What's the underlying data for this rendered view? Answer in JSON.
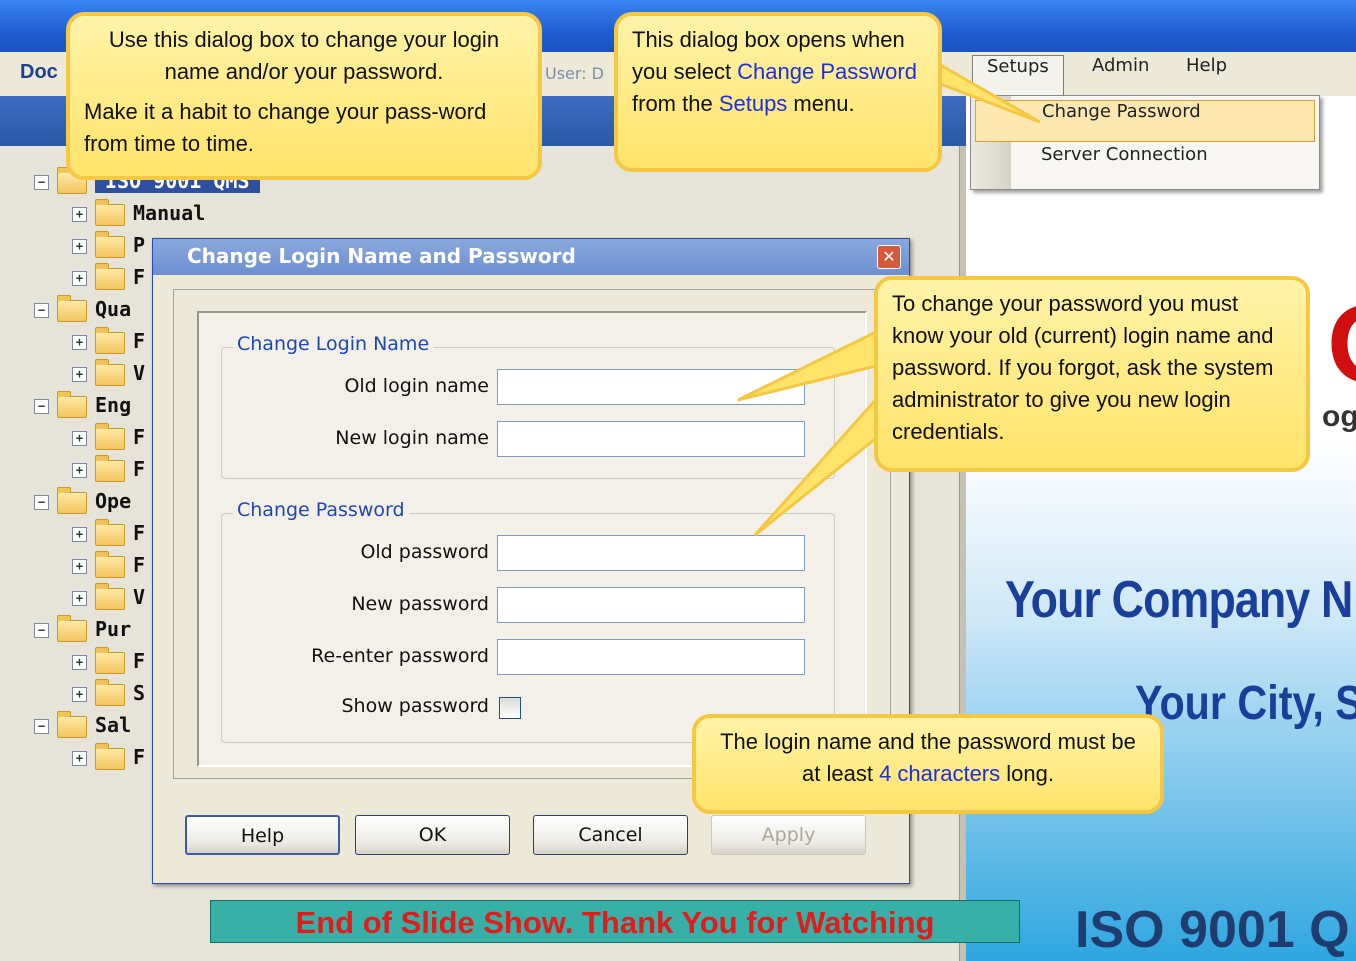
{
  "app": {
    "title_fragment": "Doc",
    "user_fragment": "User: D"
  },
  "menu": {
    "setups": "Setups",
    "admin": "Admin",
    "help": "Help"
  },
  "setups_dropdown": {
    "items": [
      "Change Password",
      "Server Connection"
    ],
    "highlighted": "Change Password"
  },
  "tree": {
    "root": "ISO 9001 QMS",
    "rows": [
      {
        "label": "Manual"
      },
      {
        "label": "P"
      },
      {
        "label": "F"
      },
      {
        "label": "Qua"
      },
      {
        "label": "F"
      },
      {
        "label": "V"
      },
      {
        "label": "Eng"
      },
      {
        "label": "F"
      },
      {
        "label": "F"
      },
      {
        "label": "Ope"
      },
      {
        "label": "F"
      },
      {
        "label": "F"
      },
      {
        "label": "V"
      },
      {
        "label": "Pur"
      },
      {
        "label": "F"
      },
      {
        "label": "S"
      },
      {
        "label": "Sal"
      },
      {
        "label": "F"
      }
    ]
  },
  "dialog": {
    "title": "Change Login Name and Password",
    "close_glyph": "✕",
    "login_group": {
      "title": "Change Login Name",
      "old_label": "Old login name",
      "new_label": "New login name",
      "old_value": "",
      "new_value": ""
    },
    "password_group": {
      "title": "Change Password",
      "old_label": "Old password",
      "new_label": "New password",
      "reenter_label": "Re-enter password",
      "show_label": "Show password",
      "old_value": "",
      "new_value": "",
      "reenter_value": "",
      "show_checked": false
    },
    "buttons": {
      "help": "Help",
      "ok": "OK",
      "cancel": "Cancel",
      "apply": "Apply"
    }
  },
  "right_panel": {
    "brand_o": "O",
    "brand_og": "og",
    "company": "Your Company N",
    "city": "Your City, S",
    "iso": "ISO 9001 Q"
  },
  "callouts": {
    "dialog_info": {
      "line1": "Use this dialog box to change your login name and/or your password.",
      "line2": "Make it a habit to change your pass-word from time to time."
    },
    "opens": {
      "pre": "This dialog box opens when you select ",
      "link1": "Change Password",
      "mid": " from the ",
      "link2": "Setups",
      "post": " menu."
    },
    "know_old": "To change your password you must know your old (current) login name and password. If you forgot, ask the system administrator to give you new login credentials.",
    "length": {
      "pre": "The login name and the password must be at least ",
      "link": "4 characters",
      "post": " long."
    }
  },
  "end_banner": "End of Slide Show.  Thank You for Watching",
  "colors": {
    "callout_fill": "#ffe36a",
    "callout_border": "#f4c843",
    "link_blue": "#1a2fe6",
    "banner_text": "#e51a1a",
    "banner_bg": "#37b0a8"
  }
}
